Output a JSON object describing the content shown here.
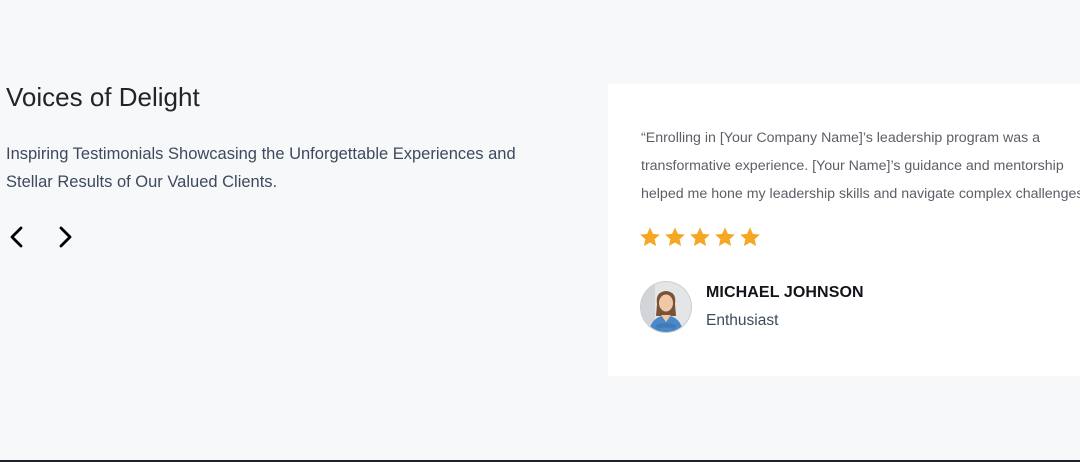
{
  "testimonials": {
    "heading": "Voices of Delight",
    "subheading": "Inspiring Testimonials Showcasing the Unforgettable Experiences and Stellar Results of Our Valued Clients.",
    "nav": {
      "prev_icon": "chevron-left-icon",
      "next_icon": "chevron-right-icon"
    },
    "card": {
      "quote": "“Enrolling in [Your Company Name]’s leadership program was a transformative experience. [Your Name]’s guidance and mentorship helped me hone my leadership skills and navigate complex challenges.",
      "rating": 5,
      "rating_max": 5,
      "star_color": "#f5a623",
      "author": {
        "name": "MICHAEL JOHNSON",
        "role": "Enthusiast"
      }
    }
  },
  "colors": {
    "background": "#f7f8fa",
    "card": "#ffffff",
    "heading": "#212529",
    "body_text": "#3d4a5c"
  }
}
